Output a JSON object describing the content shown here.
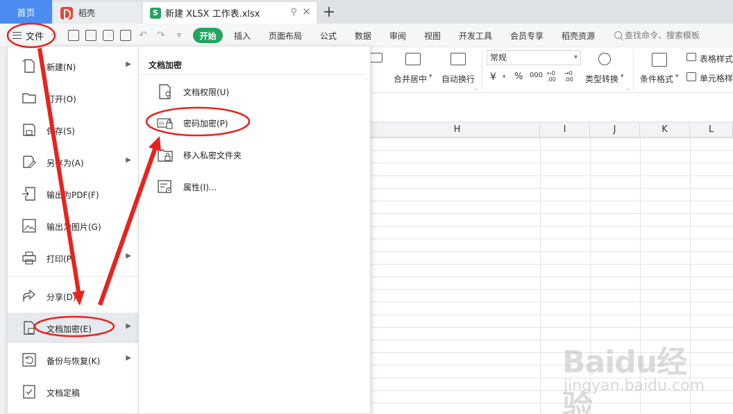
{
  "tabs": {
    "home": "首页",
    "daoke": "稻壳",
    "document": "新建 XLSX 工作表.xlsx",
    "doc_logo": "S",
    "pin": "⚲",
    "close": "✕",
    "add": "+"
  },
  "menubar": {
    "file_label": "文件",
    "chevron": "›",
    "start": "开始",
    "items": [
      "插入",
      "页面布局",
      "公式",
      "数据",
      "审阅",
      "视图",
      "开发工具",
      "会员专享",
      "稻壳资源"
    ],
    "search": "查找命令、搜索模板",
    "more": "▿"
  },
  "ribbon": {
    "merge_center": "合并居中",
    "auto_wrap": "自动换行",
    "number_format": "常规",
    "currency": "¥",
    "percent": "%",
    "thousands": "000",
    "dec_inc": "←0 .00",
    "dec_dec": "→0 .00",
    "type_convert": "类型转换",
    "cond_format": "条件格式",
    "table_style": "表格样式",
    "cell_style": "单元格样式",
    "dropdown": "▾"
  },
  "columns": [
    "H",
    "I",
    "J",
    "K",
    "L"
  ],
  "file_menu": {
    "items": [
      {
        "label": "新建(N)",
        "icon": "new-file-icon",
        "arrow": true
      },
      {
        "label": "打开(O)",
        "icon": "folder-open-icon",
        "arrow": false
      },
      {
        "label": "保存(S)",
        "icon": "save-icon",
        "arrow": false
      },
      {
        "label": "另存为(A)",
        "icon": "save-as-icon",
        "arrow": true
      },
      {
        "label": "输出为PDF(F)",
        "icon": "export-pdf-icon",
        "arrow": false
      },
      {
        "label": "输出为图片(G)",
        "icon": "export-image-icon",
        "arrow": false
      },
      {
        "label": "打印(P)",
        "icon": "print-icon",
        "arrow": true
      },
      {
        "label": "分享(D)",
        "icon": "share-icon",
        "arrow": false
      },
      {
        "label": "文档加密(E)",
        "icon": "document-encrypt-icon",
        "arrow": true
      },
      {
        "label": "备份与恢复(K)",
        "icon": "backup-restore-icon",
        "arrow": true
      },
      {
        "label": "文档定稿",
        "icon": "document-finalize-icon",
        "arrow": false
      }
    ],
    "arrow_glyph": "▶"
  },
  "submenu": {
    "title": "文档加密",
    "items": [
      {
        "label": "文档权限(U)",
        "icon": "document-permission-icon"
      },
      {
        "label": "密码加密(P)",
        "icon": "password-encrypt-icon"
      },
      {
        "label": "移入私密文件夹",
        "icon": "private-folder-icon"
      },
      {
        "label": "属性(I)...",
        "icon": "properties-icon"
      }
    ]
  },
  "watermark": {
    "main": "Baidu经验",
    "sub": "jingyan.baidu.com"
  },
  "colors": {
    "accent_blue": "#4a8cf0",
    "brand_green": "#23a461",
    "annotation_red": "#e8231e"
  }
}
